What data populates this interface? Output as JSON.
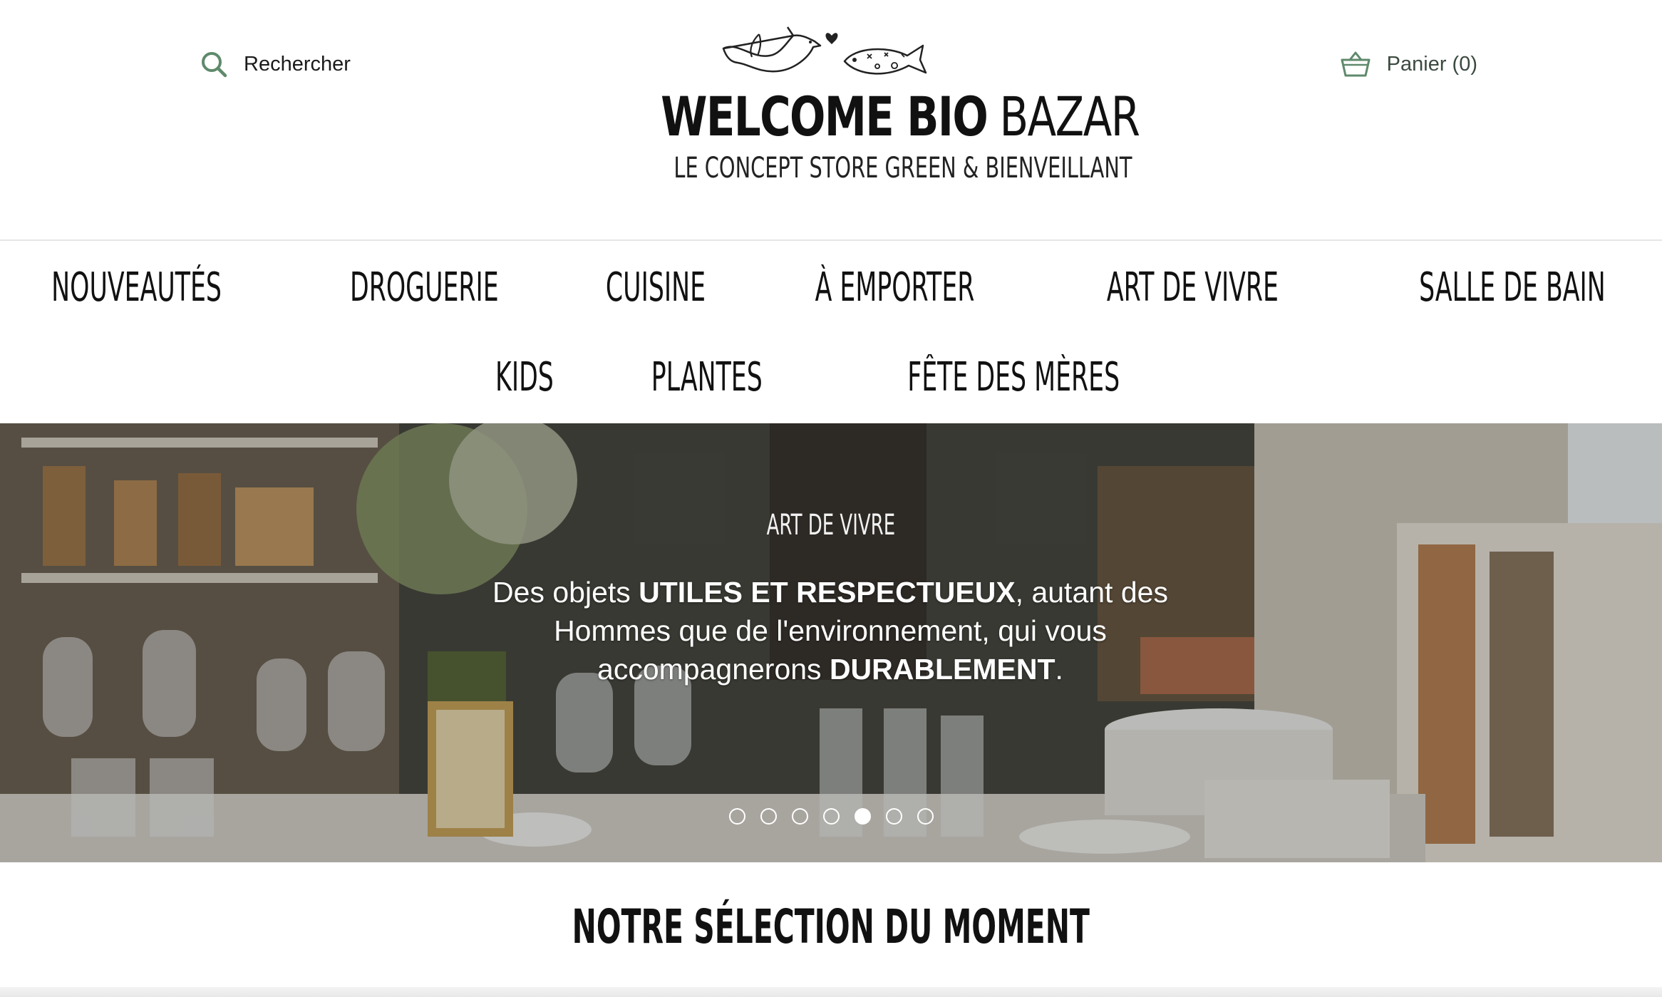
{
  "header": {
    "search_label": "Rechercher",
    "cart_label": "Panier (0)",
    "logo": {
      "title_bold": "WELCOME BIO",
      "title_light": "BAZAR",
      "tagline": "LE CONCEPT STORE GREEN & BIENVEILLANT"
    }
  },
  "colors": {
    "accent": "#5f8a6c",
    "text": "#111111"
  },
  "icons": {
    "search": "search-icon",
    "cart": "basket-icon"
  },
  "nav": {
    "row1": [
      "NOUVEAUTÉS",
      "DROGUERIE",
      "CUISINE",
      "À EMPORTER",
      "ART DE VIVRE",
      "SALLE DE BAIN"
    ],
    "row2": [
      "KIDS",
      "PLANTES",
      "FÊTE DES MÈRES"
    ]
  },
  "hero": {
    "kicker": "ART DE VIVRE",
    "text_parts": [
      "Des objets ",
      "UTILES ET RESPECTUEUX",
      ", autant des Hommes que de l'environnement, qui vous accompagnerons ",
      "DURABLEMENT",
      "."
    ],
    "slide_count": 7,
    "active_slide": 5
  },
  "section": {
    "title": "NOTRE SÉLECTION DU MOMENT"
  }
}
